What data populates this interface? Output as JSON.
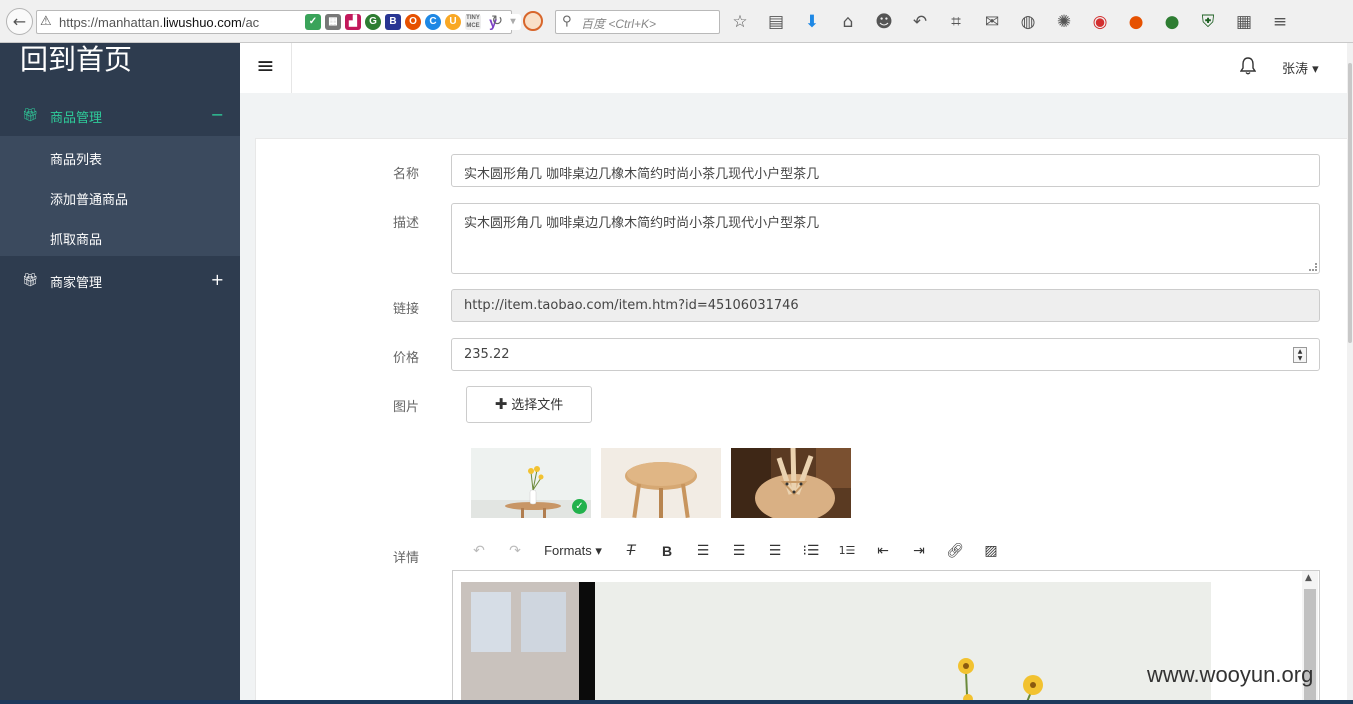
{
  "browser": {
    "url_prefix": "https://manhattan.",
    "url_domain": "liwushuo.com",
    "url_suffix": "/ac",
    "search_placeholder": "百度 <Ctrl+K>",
    "extensions": [
      "shield",
      "qr",
      "chart",
      "G",
      "B",
      "o",
      "c",
      "U",
      "TINY MCE",
      "y"
    ]
  },
  "sidebar": {
    "brand": "回到首页",
    "groups": [
      {
        "label": "商品管理",
        "toggle": "−",
        "items": [
          "商品列表",
          "添加普通商品",
          "抓取商品"
        ]
      },
      {
        "label": "商家管理",
        "toggle": "+"
      }
    ]
  },
  "topbar": {
    "user": "张涛 ▾"
  },
  "form": {
    "name_label": "名称",
    "name_value": "实木圆形角几 咖啡桌边几橡木简约时尚小茶几现代小户型茶几",
    "desc_label": "描述",
    "desc_value": "实木圆形角几 咖啡桌边几橡木简约时尚小茶几现代小户型茶几",
    "link_label": "链接",
    "link_value": "http://item.taobao.com/item.htm?id=45106031746",
    "price_label": "价格",
    "price_value": "235.22",
    "image_label": "图片",
    "choose_file": "选择文件",
    "detail_label": "详情",
    "formats": "Formats ▾"
  },
  "watermark": "www.wooyun.org",
  "colors": {
    "sidebar_bg": "#2e3c4f",
    "accent": "#2ecc9a",
    "check": "#22b14c"
  }
}
